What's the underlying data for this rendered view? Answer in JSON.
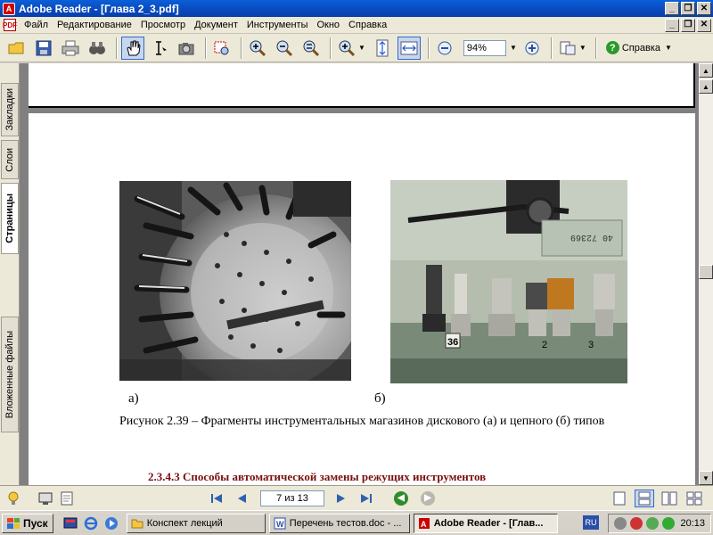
{
  "window": {
    "title": "Adobe Reader - [Глава 2_3.pdf]",
    "minimize_label": "_",
    "restore_label": "❐",
    "close_label": "✕"
  },
  "menu": {
    "items": [
      "Файл",
      "Редактирование",
      "Просмотр",
      "Документ",
      "Инструменты",
      "Окно",
      "Справка"
    ]
  },
  "toolbar": {
    "zoom_value": "94%",
    "help_label": "Справка"
  },
  "navpanel": {
    "tabs": [
      "Закладки",
      "Слои",
      "Страницы",
      "Вложенные файлы"
    ],
    "active_tab": "Страницы"
  },
  "document": {
    "caption_a": "а)",
    "caption_b": "б)",
    "figure_caption": "Рисунок 2.39 – Фрагменты инструментальных магазинов дискового (а) и цепного (б) типов",
    "section_heading": "2.3.4.3 Способы автоматической замены режущих инструментов",
    "photo_b_numbers": [
      "36",
      "2",
      "3"
    ],
    "photo_b_plate": "40 72369"
  },
  "statusbar": {
    "page_indicator": "7 из 13"
  },
  "taskbar": {
    "start_label": "Пуск",
    "tasks": [
      {
        "label": "Конспект лекций",
        "active": false
      },
      {
        "label": "Перечень тестов.doc - ...",
        "active": false
      },
      {
        "label": "Adobe Reader - [Глав...",
        "active": true
      }
    ],
    "language": "RU",
    "clock": "20:13"
  },
  "colors": {
    "titlebar": "#0a4fc4",
    "heading": "#7a1010",
    "accent_blue": "#316ac5"
  }
}
